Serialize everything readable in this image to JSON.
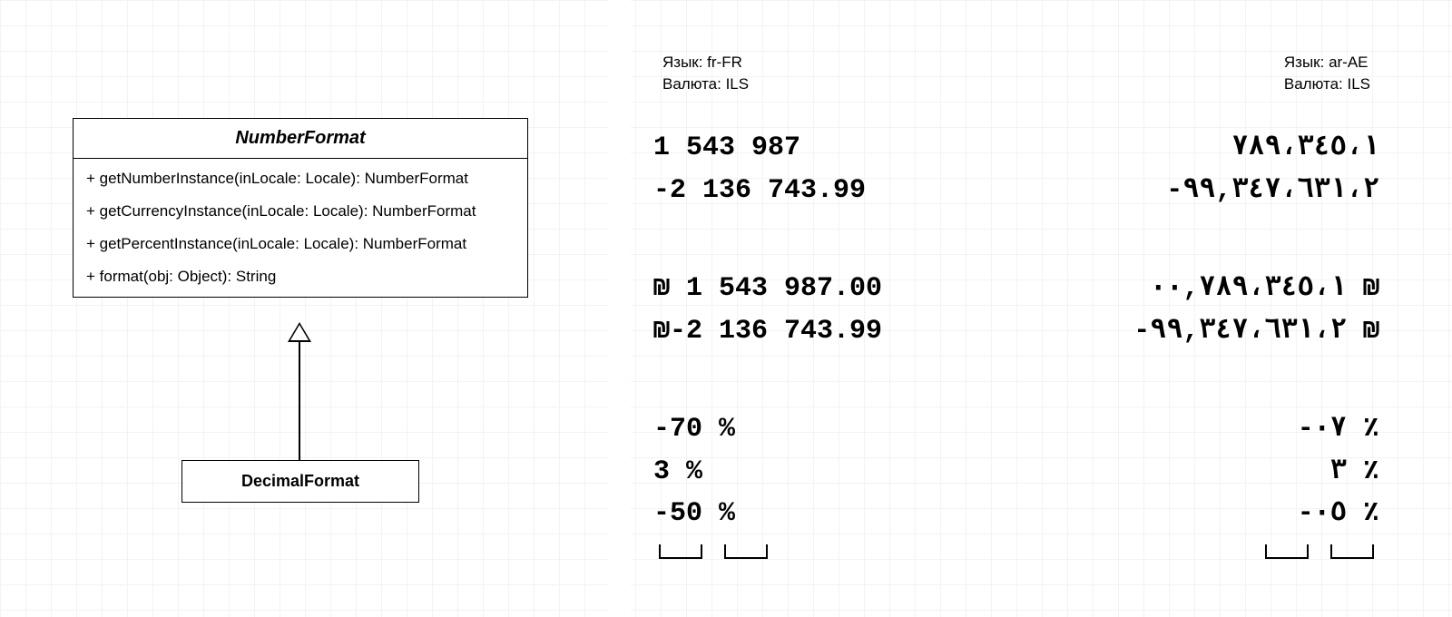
{
  "uml": {
    "parent": {
      "name": "NumberFormat",
      "methods": [
        "+ getNumberInstance(inLocale: Locale): NumberFormat",
        "+ getCurrencyInstance(inLocale: Locale): NumberFormat",
        "+ getPercentInstance(inLocale: Locale): NumberFormat",
        "+ format(obj: Object): String"
      ]
    },
    "child": {
      "name": "DecimalFormat"
    }
  },
  "panels": {
    "left": {
      "lang_line": "Язык: fr-FR",
      "curr_line": "Валюта: ILS",
      "numbers": "1 543 987\n-2 136 743.99",
      "currency": "₪ 1 543 987.00\n₪-2 136 743.99",
      "percent": "-70 %\n3 %\n-50 %"
    },
    "right": {
      "lang_line": "Язык: ar-AE",
      "curr_line": "Валюта: ILS",
      "numbers": "٧٨٩،٣٤٥،١\n٩٩,٣٤٧،٦٣١،٢-",
      "currency": "₪ ٠٠,٧٨٩،٣٤٥،١\n₪ ٩٩,٣٤٧،٦٣١،٢-",
      "percent": "٪ ٠٧-\n٪ ٣\n٪ ٠٥-"
    }
  }
}
